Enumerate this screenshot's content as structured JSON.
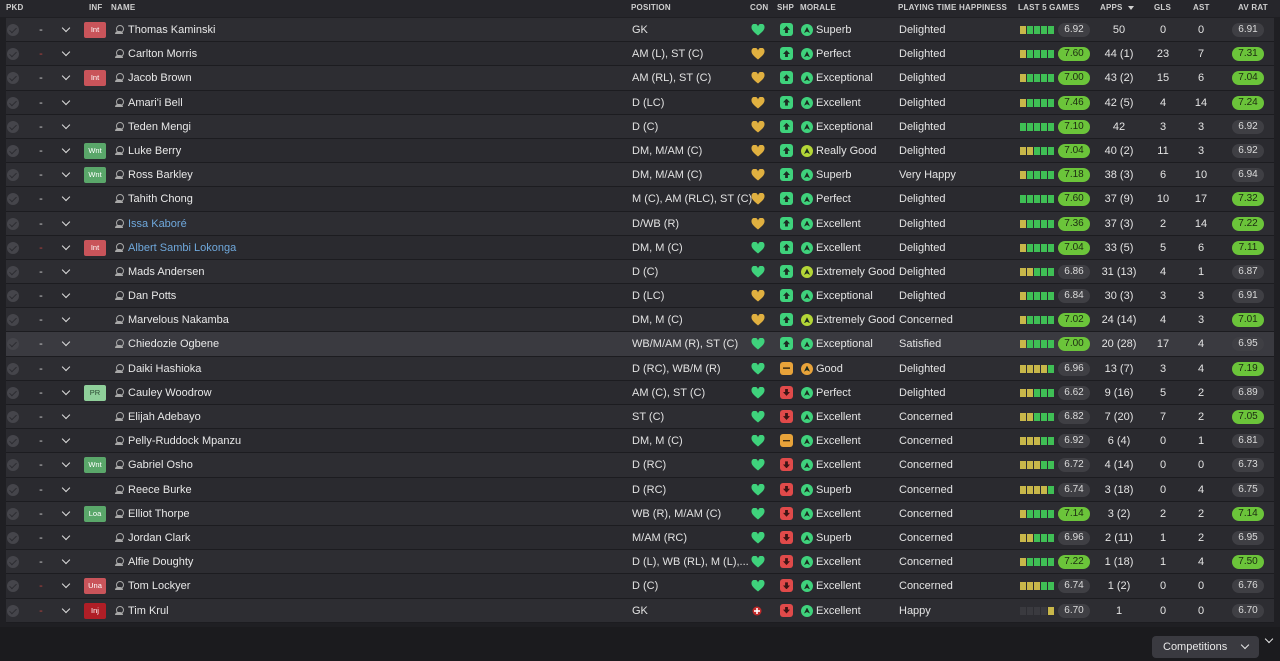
{
  "header": {
    "pkd": "PKD",
    "inf": "INF",
    "name": "NAME",
    "position": "POSITION",
    "con": "CON",
    "shp": "SHP",
    "morale": "MORALE",
    "playing_time": "PLAYING TIME HAPPINESS",
    "last5": "LAST 5 GAMES",
    "apps": "APPS",
    "gls": "GLS",
    "ast": "AST",
    "avrat": "AV RAT"
  },
  "icons": {
    "pick": "check-circle-icon",
    "chevron": "chevron-down-icon",
    "person": "person-icon",
    "condition_heart": "heart-icon",
    "sharpness": "arrow-icon",
    "morale": "morale-icon"
  },
  "colors": {
    "rating_green": "#6bc43a",
    "rating_grey": "#3f3f44",
    "inf_red": "#c9545a",
    "inf_green": "#5aa76a",
    "inf_light_green": "#8fcf9a",
    "inf_dark_red": "#b01e26",
    "heart_green": "#3fd27c",
    "heart_gold": "#e0b040",
    "link_blue": "#6fa8dc"
  },
  "players": [
    {
      "pkd": "-",
      "pkd_red": false,
      "inf": "Int",
      "inf_color": "red",
      "name": "Thomas Kaminski",
      "link": false,
      "position": "GK",
      "con": "green",
      "shp": "green",
      "morale_icon": "green",
      "morale": "Superb",
      "pth": "Delighted",
      "last5": [
        "y",
        "g",
        "g",
        "g",
        "g"
      ],
      "l5rating": "6.92",
      "l5green": false,
      "apps": "50",
      "gls": "0",
      "ast": "0",
      "avrat": "6.91",
      "avgreen": false
    },
    {
      "pkd": "-",
      "pkd_red": true,
      "inf": "",
      "inf_color": "",
      "name": "Carlton Morris",
      "link": false,
      "position": "AM (L), ST (C)",
      "con": "gold",
      "shp": "green",
      "morale_icon": "green",
      "morale": "Perfect",
      "pth": "Delighted",
      "last5": [
        "y",
        "g",
        "g",
        "g",
        "g"
      ],
      "l5rating": "7.60",
      "l5green": true,
      "apps": "44 (1)",
      "gls": "23",
      "ast": "7",
      "avrat": "7.31",
      "avgreen": true
    },
    {
      "pkd": "-",
      "pkd_red": false,
      "inf": "Int",
      "inf_color": "red",
      "name": "Jacob Brown",
      "link": false,
      "position": "AM (RL), ST (C)",
      "con": "gold",
      "shp": "green",
      "morale_icon": "green",
      "morale": "Exceptional",
      "pth": "Delighted",
      "last5": [
        "y",
        "g",
        "g",
        "g",
        "g"
      ],
      "l5rating": "7.00",
      "l5green": true,
      "apps": "43 (2)",
      "gls": "15",
      "ast": "6",
      "avrat": "7.04",
      "avgreen": true
    },
    {
      "pkd": "-",
      "pkd_red": false,
      "inf": "",
      "inf_color": "",
      "name": "Amari'i Bell",
      "link": false,
      "position": "D (LC)",
      "con": "gold",
      "shp": "green",
      "morale_icon": "green",
      "morale": "Excellent",
      "pth": "Delighted",
      "last5": [
        "y",
        "g",
        "g",
        "g",
        "g"
      ],
      "l5rating": "7.46",
      "l5green": true,
      "apps": "42 (5)",
      "gls": "4",
      "ast": "14",
      "avrat": "7.24",
      "avgreen": true
    },
    {
      "pkd": "-",
      "pkd_red": false,
      "inf": "",
      "inf_color": "",
      "name": "Teden Mengi",
      "link": false,
      "position": "D (C)",
      "con": "gold",
      "shp": "green",
      "morale_icon": "green",
      "morale": "Exceptional",
      "pth": "Delighted",
      "last5": [
        "g",
        "g",
        "g",
        "g",
        "g"
      ],
      "l5rating": "7.10",
      "l5green": true,
      "apps": "42",
      "gls": "3",
      "ast": "3",
      "avrat": "6.92",
      "avgreen": false
    },
    {
      "pkd": "-",
      "pkd_red": false,
      "inf": "Wnt",
      "inf_color": "green",
      "name": "Luke Berry",
      "link": false,
      "position": "DM, M/AM (C)",
      "con": "gold",
      "shp": "green",
      "morale_icon": "lime",
      "morale": "Really Good",
      "pth": "Delighted",
      "last5": [
        "y",
        "y",
        "g",
        "g",
        "g"
      ],
      "l5rating": "7.04",
      "l5green": true,
      "apps": "40 (2)",
      "gls": "11",
      "ast": "3",
      "avrat": "6.92",
      "avgreen": false
    },
    {
      "pkd": "-",
      "pkd_red": false,
      "inf": "Wnt",
      "inf_color": "green",
      "name": "Ross Barkley",
      "link": false,
      "position": "DM, M/AM (C)",
      "con": "gold",
      "shp": "green",
      "morale_icon": "green",
      "morale": "Superb",
      "pth": "Very Happy",
      "last5": [
        "y",
        "g",
        "g",
        "g",
        "g"
      ],
      "l5rating": "7.18",
      "l5green": true,
      "apps": "38 (3)",
      "gls": "6",
      "ast": "10",
      "avrat": "6.94",
      "avgreen": false
    },
    {
      "pkd": "-",
      "pkd_red": false,
      "inf": "",
      "inf_color": "",
      "name": "Tahith Chong",
      "link": false,
      "position": "M (C), AM (RLC), ST (C)",
      "con": "gold",
      "shp": "green",
      "morale_icon": "green",
      "morale": "Perfect",
      "pth": "Delighted",
      "last5": [
        "g",
        "g",
        "g",
        "g",
        "g"
      ],
      "l5rating": "7.60",
      "l5green": true,
      "apps": "37 (9)",
      "gls": "10",
      "ast": "17",
      "avrat": "7.32",
      "avgreen": true
    },
    {
      "pkd": "-",
      "pkd_red": false,
      "inf": "",
      "inf_color": "",
      "name": "Issa Kaboré",
      "link": true,
      "position": "D/WB (R)",
      "con": "gold",
      "shp": "green",
      "morale_icon": "green",
      "morale": "Excellent",
      "pth": "Delighted",
      "last5": [
        "y",
        "g",
        "g",
        "g",
        "g"
      ],
      "l5rating": "7.36",
      "l5green": true,
      "apps": "37 (3)",
      "gls": "2",
      "ast": "14",
      "avrat": "7.22",
      "avgreen": true
    },
    {
      "pkd": "-",
      "pkd_red": true,
      "inf": "Int",
      "inf_color": "red",
      "name": "Albert Sambi Lokonga",
      "link": true,
      "position": "DM, M (C)",
      "con": "green",
      "shp": "green",
      "morale_icon": "green",
      "morale": "Excellent",
      "pth": "Delighted",
      "last5": [
        "y",
        "g",
        "g",
        "g",
        "g"
      ],
      "l5rating": "7.04",
      "l5green": true,
      "apps": "33 (5)",
      "gls": "5",
      "ast": "6",
      "avrat": "7.11",
      "avgreen": true
    },
    {
      "pkd": "-",
      "pkd_red": false,
      "inf": "",
      "inf_color": "",
      "name": "Mads Andersen",
      "link": false,
      "position": "D (C)",
      "con": "green",
      "shp": "green",
      "morale_icon": "lime",
      "morale": "Extremely Good",
      "pth": "Delighted",
      "last5": [
        "y",
        "y",
        "g",
        "g",
        "g"
      ],
      "l5rating": "6.86",
      "l5green": false,
      "apps": "31 (13)",
      "gls": "4",
      "ast": "1",
      "avrat": "6.87",
      "avgreen": false
    },
    {
      "pkd": "-",
      "pkd_red": false,
      "inf": "",
      "inf_color": "",
      "name": "Dan Potts",
      "link": false,
      "position": "D (LC)",
      "con": "gold",
      "shp": "green",
      "morale_icon": "green",
      "morale": "Exceptional",
      "pth": "Delighted",
      "last5": [
        "y",
        "g",
        "g",
        "g",
        "g"
      ],
      "l5rating": "6.84",
      "l5green": false,
      "apps": "30 (3)",
      "gls": "3",
      "ast": "3",
      "avrat": "6.91",
      "avgreen": false
    },
    {
      "pkd": "-",
      "pkd_red": false,
      "inf": "",
      "inf_color": "",
      "name": "Marvelous Nakamba",
      "link": false,
      "position": "DM, M (C)",
      "con": "gold",
      "shp": "green",
      "morale_icon": "lime",
      "morale": "Extremely Good",
      "pth": "Concerned",
      "last5": [
        "y",
        "g",
        "g",
        "g",
        "g"
      ],
      "l5rating": "7.02",
      "l5green": true,
      "apps": "24 (14)",
      "gls": "4",
      "ast": "3",
      "avrat": "7.01",
      "avgreen": true
    },
    {
      "pkd": "-",
      "pkd_red": false,
      "inf": "",
      "inf_color": "",
      "name": "Chiedozie Ogbene",
      "link": false,
      "position": "WB/M/AM (R), ST (C)",
      "con": "green",
      "shp": "green",
      "morale_icon": "green",
      "morale": "Exceptional",
      "pth": "Satisfied",
      "last5": [
        "y",
        "g",
        "g",
        "g",
        "g"
      ],
      "l5rating": "7.00",
      "l5green": true,
      "apps": "20 (28)",
      "gls": "17",
      "ast": "4",
      "avrat": "6.95",
      "avgreen": false
    },
    {
      "pkd": "-",
      "pkd_red": false,
      "inf": "",
      "inf_color": "",
      "name": "Daiki Hashioka",
      "link": false,
      "position": "D (RC), WB/M (R)",
      "con": "green",
      "shp": "orange",
      "morale_icon": "orange",
      "morale": "Good",
      "pth": "Delighted",
      "last5": [
        "y",
        "y",
        "y",
        "y",
        "g"
      ],
      "l5rating": "6.96",
      "l5green": false,
      "apps": "13 (7)",
      "gls": "3",
      "ast": "4",
      "avrat": "7.19",
      "avgreen": true
    },
    {
      "pkd": "-",
      "pkd_red": false,
      "inf": "PR",
      "inf_color": "lightgreen",
      "name": "Cauley Woodrow",
      "link": false,
      "position": "AM (C), ST (C)",
      "con": "green",
      "shp": "red",
      "morale_icon": "green",
      "morale": "Perfect",
      "pth": "Delighted",
      "last5": [
        "y",
        "y",
        "g",
        "g",
        "g"
      ],
      "l5rating": "6.62",
      "l5green": false,
      "apps": "9 (16)",
      "gls": "5",
      "ast": "2",
      "avrat": "6.89",
      "avgreen": false
    },
    {
      "pkd": "-",
      "pkd_red": false,
      "inf": "",
      "inf_color": "",
      "name": "Elijah Adebayo",
      "link": false,
      "position": "ST (C)",
      "con": "green",
      "shp": "red",
      "morale_icon": "green",
      "morale": "Excellent",
      "pth": "Concerned",
      "last5": [
        "y",
        "y",
        "g",
        "g",
        "g"
      ],
      "l5rating": "6.82",
      "l5green": false,
      "apps": "7 (20)",
      "gls": "7",
      "ast": "2",
      "avrat": "7.05",
      "avgreen": true
    },
    {
      "pkd": "-",
      "pkd_red": false,
      "inf": "",
      "inf_color": "",
      "name": "Pelly-Ruddock Mpanzu",
      "link": false,
      "position": "DM, M (C)",
      "con": "green",
      "shp": "orange",
      "morale_icon": "green",
      "morale": "Excellent",
      "pth": "Concerned",
      "last5": [
        "y",
        "y",
        "y",
        "g",
        "g"
      ],
      "l5rating": "6.92",
      "l5green": false,
      "apps": "6 (4)",
      "gls": "0",
      "ast": "1",
      "avrat": "6.81",
      "avgreen": false
    },
    {
      "pkd": "-",
      "pkd_red": false,
      "inf": "Wnt",
      "inf_color": "green",
      "name": "Gabriel Osho",
      "link": false,
      "position": "D (RC)",
      "con": "green",
      "shp": "red",
      "morale_icon": "green",
      "morale": "Excellent",
      "pth": "Concerned",
      "last5": [
        "y",
        "y",
        "y",
        "g",
        "g"
      ],
      "l5rating": "6.72",
      "l5green": false,
      "apps": "4 (14)",
      "gls": "0",
      "ast": "0",
      "avrat": "6.73",
      "avgreen": false
    },
    {
      "pkd": "-",
      "pkd_red": false,
      "inf": "",
      "inf_color": "",
      "name": "Reece Burke",
      "link": false,
      "position": "D (RC)",
      "con": "green",
      "shp": "red",
      "morale_icon": "green",
      "morale": "Superb",
      "pth": "Concerned",
      "last5": [
        "y",
        "y",
        "y",
        "y",
        "g"
      ],
      "l5rating": "6.74",
      "l5green": false,
      "apps": "3 (18)",
      "gls": "0",
      "ast": "4",
      "avrat": "6.75",
      "avgreen": false
    },
    {
      "pkd": "-",
      "pkd_red": false,
      "inf": "Loa",
      "inf_color": "green",
      "name": "Elliot Thorpe",
      "link": false,
      "position": "WB (R), M/AM (C)",
      "con": "green",
      "shp": "red",
      "morale_icon": "green",
      "morale": "Excellent",
      "pth": "Concerned",
      "last5": [
        "y",
        "g",
        "g",
        "g",
        "g"
      ],
      "l5rating": "7.14",
      "l5green": true,
      "apps": "3 (2)",
      "gls": "2",
      "ast": "2",
      "avrat": "7.14",
      "avgreen": true
    },
    {
      "pkd": "-",
      "pkd_red": false,
      "inf": "",
      "inf_color": "",
      "name": "Jordan Clark",
      "link": false,
      "position": "M/AM (RC)",
      "con": "green",
      "shp": "red",
      "morale_icon": "green",
      "morale": "Superb",
      "pth": "Concerned",
      "last5": [
        "y",
        "y",
        "g",
        "g",
        "g"
      ],
      "l5rating": "6.96",
      "l5green": false,
      "apps": "2 (11)",
      "gls": "1",
      "ast": "2",
      "avrat": "6.95",
      "avgreen": false
    },
    {
      "pkd": "-",
      "pkd_red": false,
      "inf": "",
      "inf_color": "",
      "name": "Alfie Doughty",
      "link": false,
      "position": "D (L), WB (RL), M (L),...",
      "con": "green",
      "shp": "red",
      "morale_icon": "green",
      "morale": "Excellent",
      "pth": "Concerned",
      "last5": [
        "y",
        "g",
        "g",
        "g",
        "g"
      ],
      "l5rating": "7.22",
      "l5green": true,
      "apps": "1 (18)",
      "gls": "1",
      "ast": "4",
      "avrat": "7.50",
      "avgreen": true
    },
    {
      "pkd": "-",
      "pkd_red": true,
      "inf": "Una",
      "inf_color": "red",
      "name": "Tom Lockyer",
      "link": false,
      "position": "D (C)",
      "con": "green",
      "shp": "red",
      "morale_icon": "green",
      "morale": "Excellent",
      "pth": "Concerned",
      "last5": [
        "y",
        "y",
        "y",
        "g",
        "g"
      ],
      "l5rating": "6.74",
      "l5green": false,
      "apps": "1 (2)",
      "gls": "0",
      "ast": "0",
      "avrat": "6.76",
      "avgreen": false
    },
    {
      "pkd": "-",
      "pkd_red": true,
      "inf": "Inj",
      "inf_color": "darkred",
      "name": "Tim Krul",
      "link": false,
      "position": "GK",
      "con": "injured",
      "shp": "red",
      "morale_icon": "green",
      "morale": "Excellent",
      "pth": "Happy",
      "last5": [
        "gg",
        "gg",
        "gg",
        "gg",
        "y"
      ],
      "l5rating": "6.70",
      "l5green": false,
      "apps": "1",
      "gls": "0",
      "ast": "0",
      "avrat": "6.70",
      "avgreen": false
    }
  ],
  "footer": {
    "competitions_label": "Competitions"
  }
}
